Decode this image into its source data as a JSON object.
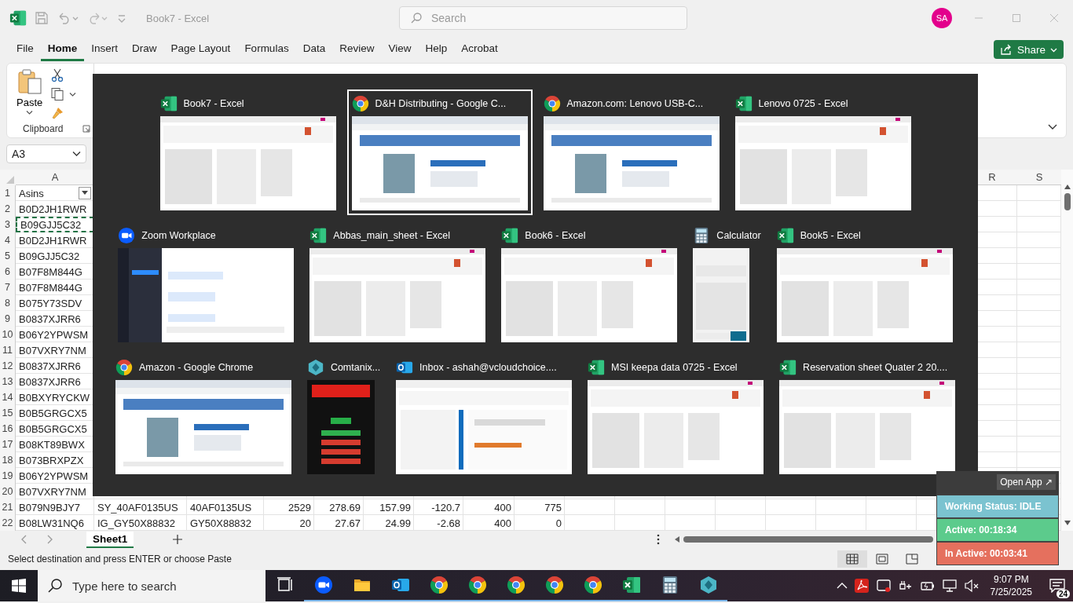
{
  "window": {
    "title": "Book7 - Excel",
    "user_initials": "SA"
  },
  "search": {
    "placeholder": "Search"
  },
  "menu_tabs": [
    {
      "label": "File",
      "selected": false
    },
    {
      "label": "Home",
      "selected": true
    },
    {
      "label": "Insert",
      "selected": false
    },
    {
      "label": "Draw",
      "selected": false
    },
    {
      "label": "Page Layout",
      "selected": false
    },
    {
      "label": "Formulas",
      "selected": false
    },
    {
      "label": "Data",
      "selected": false
    },
    {
      "label": "Review",
      "selected": false
    },
    {
      "label": "View",
      "selected": false
    },
    {
      "label": "Help",
      "selected": false
    },
    {
      "label": "Acrobat",
      "selected": false
    }
  ],
  "share_button": "Share",
  "clipboard": {
    "paste": "Paste",
    "group_label": "Clipboard"
  },
  "name_box": "A3",
  "column_headers": [
    "A",
    "R",
    "S"
  ],
  "rows": [
    {
      "number": "1",
      "kind": "header",
      "marquee": false,
      "cells": [
        "Asins"
      ]
    },
    {
      "number": "2",
      "kind": "data",
      "marquee": false,
      "cells": [
        "B0D2JH1RWR"
      ]
    },
    {
      "number": "3",
      "kind": "data",
      "marquee": true,
      "cells": [
        "B09GJJ5C32"
      ]
    },
    {
      "number": "4",
      "kind": "data",
      "marquee": false,
      "cells": [
        "B0D2JH1RWR"
      ]
    },
    {
      "number": "5",
      "kind": "data",
      "marquee": false,
      "cells": [
        "B09GJJ5C32"
      ]
    },
    {
      "number": "6",
      "kind": "data",
      "marquee": false,
      "cells": [
        "B07F8M844G"
      ]
    },
    {
      "number": "7",
      "kind": "data",
      "marquee": false,
      "cells": [
        "B07F8M844G"
      ]
    },
    {
      "number": "8",
      "kind": "data",
      "marquee": false,
      "cells": [
        "B075Y73SDV"
      ]
    },
    {
      "number": "9",
      "kind": "data",
      "marquee": false,
      "cells": [
        "B0837XJRR6"
      ]
    },
    {
      "number": "10",
      "kind": "data",
      "marquee": false,
      "cells": [
        "B06Y2YPWSM"
      ]
    },
    {
      "number": "11",
      "kind": "data",
      "marquee": false,
      "cells": [
        "B07VXRY7NM"
      ]
    },
    {
      "number": "12",
      "kind": "data",
      "marquee": false,
      "cells": [
        "B0837XJRR6"
      ]
    },
    {
      "number": "13",
      "kind": "data",
      "marquee": false,
      "cells": [
        "B0837XJRR6"
      ]
    },
    {
      "number": "14",
      "kind": "data",
      "marquee": false,
      "cells": [
        "B0BXYRYCKW"
      ]
    },
    {
      "number": "15",
      "kind": "data",
      "marquee": false,
      "cells": [
        "B0B5GRGCX5"
      ]
    },
    {
      "number": "16",
      "kind": "data",
      "marquee": false,
      "cells": [
        "B0B5GRGCX5"
      ]
    },
    {
      "number": "17",
      "kind": "data",
      "marquee": false,
      "cells": [
        "B08KT89BWX"
      ]
    },
    {
      "number": "18",
      "kind": "data",
      "marquee": false,
      "cells": [
        "B073BRXPZX"
      ]
    },
    {
      "number": "19",
      "kind": "data",
      "marquee": false,
      "cells": [
        "B06Y2YPWSM"
      ]
    },
    {
      "number": "20",
      "kind": "data",
      "marquee": false,
      "cells": [
        "B07VXRY7NM"
      ]
    },
    {
      "number": "21",
      "kind": "data",
      "marquee": false,
      "cells": [
        "B079N9BJY7",
        "SY_40AF0135US",
        "40AF0135US",
        "2529",
        "278.69",
        "157.99",
        "-120.7",
        "400",
        "775"
      ]
    },
    {
      "number": "22",
      "kind": "data",
      "marquee": false,
      "cells": [
        "B08LW31NQ6",
        "IG_GY50X88832",
        "GY50X88832",
        "20",
        "27.67",
        "24.99",
        "-2.68",
        "400",
        "0"
      ]
    }
  ],
  "sheet_tabs": [
    {
      "label": "Sheet1",
      "selected": true
    }
  ],
  "status_text": "Select destination and press ENTER or choose Paste",
  "switcher": {
    "rows": [
      [
        {
          "title": "Book7 - Excel",
          "icon": {
            "kind": "excel"
          },
          "preview": {
            "kind": "sheet"
          },
          "selected": false
        },
        {
          "title": "D&H Distributing - Google C...",
          "icon": {
            "kind": "chrome"
          },
          "preview": {
            "kind": "browser"
          },
          "selected": true
        },
        {
          "title": "Amazon.com: Lenovo USB-C...",
          "icon": {
            "kind": "chrome"
          },
          "preview": {
            "kind": "browser"
          },
          "selected": false
        },
        {
          "title": "Lenovo 0725 - Excel",
          "icon": {
            "kind": "excel"
          },
          "preview": {
            "kind": "sheet"
          },
          "selected": false
        }
      ],
      [
        {
          "title": "Zoom Workplace",
          "icon": {
            "kind": "zoom"
          },
          "preview": {
            "kind": "chat"
          },
          "selected": false
        },
        {
          "title": "Abbas_main_sheet - Excel",
          "icon": {
            "kind": "excel"
          },
          "preview": {
            "kind": "sheet"
          },
          "selected": false
        },
        {
          "title": "Book6 - Excel",
          "icon": {
            "kind": "excel"
          },
          "preview": {
            "kind": "sheet"
          },
          "selected": false
        },
        {
          "title": "Calculator",
          "icon": {
            "kind": "calculator"
          },
          "preview": {
            "kind": "calculator"
          },
          "selected": false
        },
        {
          "title": "Book5 - Excel",
          "icon": {
            "kind": "excel"
          },
          "preview": {
            "kind": "sheet"
          },
          "selected": false
        }
      ],
      [
        {
          "title": "Amazon - Google Chrome",
          "icon": {
            "kind": "chrome"
          },
          "preview": {
            "kind": "browser"
          },
          "selected": false
        },
        {
          "title": "Comtanix...",
          "icon": {
            "kind": "comtanix"
          },
          "preview": {
            "kind": "dark"
          },
          "selected": false
        },
        {
          "title": "Inbox - ashah@vcloudchoice....",
          "icon": {
            "kind": "outlook"
          },
          "preview": {
            "kind": "mail"
          },
          "selected": false
        },
        {
          "title": "MSI keepa data 0725 - Excel",
          "icon": {
            "kind": "excel"
          },
          "preview": {
            "kind": "sheet"
          },
          "selected": false
        },
        {
          "title": "Reservation sheet Quater 2 20....",
          "icon": {
            "kind": "excel"
          },
          "preview": {
            "kind": "sheet"
          },
          "selected": false
        }
      ]
    ]
  },
  "tracker": {
    "open_app": "Open App ↗",
    "statuses": [
      {
        "text": "Working Status: IDLE",
        "color": "#7bc3d0"
      },
      {
        "text": "Active: 00:18:34",
        "color": "#5ccb8c"
      },
      {
        "text": "In Active: 00:03:41",
        "color": "#e5705e"
      }
    ]
  },
  "taskbar": {
    "search_placeholder": "Type here to search",
    "apps": [
      {
        "kind": "taskview"
      },
      {
        "kind": "zoom"
      },
      {
        "kind": "folder"
      },
      {
        "kind": "outlook"
      },
      {
        "kind": "chrome"
      },
      {
        "kind": "chrome"
      },
      {
        "kind": "chrome"
      },
      {
        "kind": "chrome"
      },
      {
        "kind": "chrome"
      },
      {
        "kind": "excel"
      },
      {
        "kind": "calculator"
      },
      {
        "kind": "comtanix"
      }
    ],
    "time": "9:07 PM",
    "date": "7/25/2025",
    "notifications": "24"
  }
}
